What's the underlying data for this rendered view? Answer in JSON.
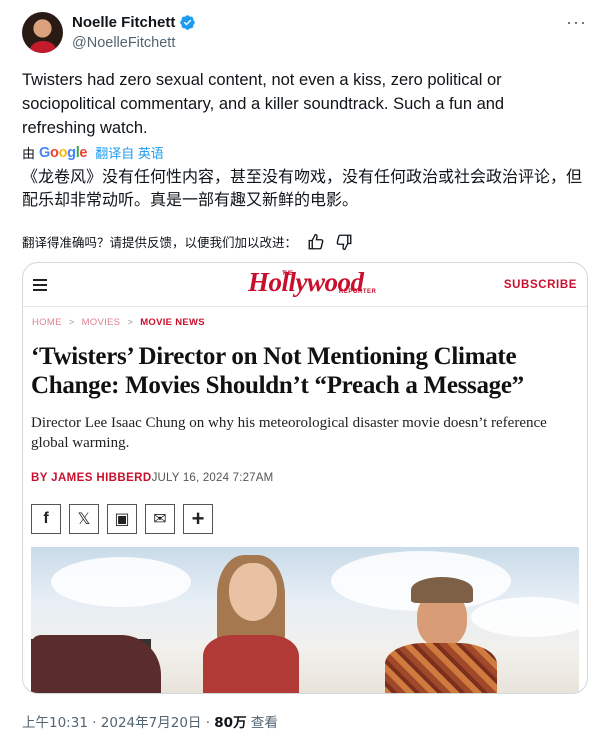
{
  "author": {
    "name": "Noelle Fitchett",
    "handle": "@NoelleFitchett"
  },
  "tweet": {
    "text": "Twisters had zero sexual content, not even a kiss, zero political or sociopolitical commentary, and a killer soundtrack. Such a fun and refreshing watch.",
    "translation_by": "由",
    "google": [
      "G",
      "o",
      "o",
      "g",
      "l",
      "e"
    ],
    "translation_label": "翻译自 英语",
    "translated_text": "《龙卷风》没有任何性内容，甚至没有吻戏，没有任何政治或社会政治评论，但配乐却非常动听。真是一部有趣又新鲜的电影。",
    "feedback_prompt": "翻译得准确吗？请提供反馈，以便我们加以改进："
  },
  "card": {
    "logo": "Hollywood",
    "logo_the": "THE",
    "logo_sub": "REPORTER",
    "subscribe": "SUBSCRIBE",
    "breadcrumbs": [
      "HOME",
      "MOVIES",
      "MOVIE NEWS"
    ],
    "crumb_sep": ">",
    "headline": "‘Twisters’ Director on Not Mentioning Climate Change: Movies Shouldn’t “Preach a Message”",
    "dek": "Director Lee Isaac Chung on why his meteorological disaster movie doesn’t reference global warming.",
    "byline": "BY JAMES HIBBERD",
    "date": "JULY 16, 2024 7:27AM",
    "share_buttons": [
      "f",
      "𝕏",
      "▣",
      "✉",
      "+"
    ]
  },
  "meta": {
    "timestamp": "上午10:31 · 2024年7月20日 · ",
    "views": "80万",
    "views_label": " 查看"
  },
  "colors": {
    "verified": "#1d9bf0",
    "thr_red": "#c8102e",
    "link_blue": "#1d9bf0"
  }
}
